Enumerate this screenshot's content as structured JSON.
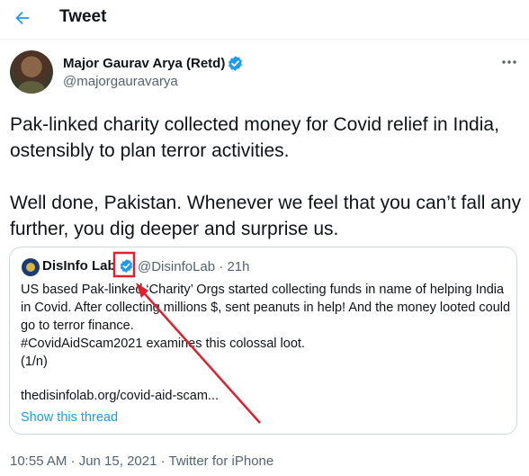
{
  "header": {
    "title": "Tweet",
    "back_icon": "arrow-left-icon"
  },
  "author": {
    "name": "Major Gaurav Arya (Retd)",
    "handle": "@majorgauravarya",
    "verified_icon": "verified-badge-icon"
  },
  "tweet": {
    "text": "Pak-linked charity collected money for Covid relief in India, ostensibly to plan terror activities.\n\nWell done, Pakistan. Whenever we feel that you can’t fall any further, you dig deeper and surprise us."
  },
  "quote": {
    "name": "DisInfo Lab",
    "handle": "@DisinfoLab",
    "separator": " · ",
    "time": "21h",
    "text": "US based Pak-linked ‘Charity’ Orgs started collecting funds in name of helping India in Covid. After collecting millions $, sent peanuts in help! And the money looted could go to terror finance.\n #CovidAidScam2021 examines this colossal loot.\n(1/n)",
    "link": "thedisinfolab.org/covid-aid-scam...",
    "show_thread": "Show this thread"
  },
  "footer": {
    "timestamp": "10:55 AM · Jun 15, 2021 · Twitter for iPhone"
  },
  "colors": {
    "accent": "#1d9bf0",
    "secondary_text": "#536471",
    "border": "#cfd9de",
    "annotation_red": "#e0202e"
  }
}
